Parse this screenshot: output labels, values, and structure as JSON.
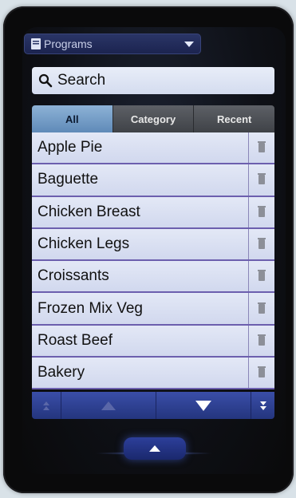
{
  "header": {
    "dropdown_label": "Programs"
  },
  "search": {
    "placeholder": "Search"
  },
  "tabs": [
    {
      "label": "All",
      "active": true
    },
    {
      "label": "Category",
      "active": false
    },
    {
      "label": "Recent",
      "active": false
    }
  ],
  "programs": [
    {
      "name": "Apple Pie"
    },
    {
      "name": "Baguette"
    },
    {
      "name": "Chicken Breast"
    },
    {
      "name": "Chicken Legs"
    },
    {
      "name": "Croissants"
    },
    {
      "name": "Frozen Mix Veg"
    },
    {
      "name": "Roast Beef"
    },
    {
      "name": "Bakery"
    }
  ],
  "icons": {
    "dropdown": "document-icon",
    "dropdown_caret": "chevron-down-icon",
    "search": "search-icon",
    "delete": "trash-icon",
    "scroll_top": "scroll-to-top-icon",
    "scroll_up": "arrow-up-icon",
    "scroll_down": "arrow-down-icon",
    "scroll_bottom": "scroll-to-bottom-icon",
    "handle": "arrow-up-icon"
  },
  "colors": {
    "tab_active": "#7fa6cf",
    "list_row": "#dde3f4",
    "row_divider": "#6c5fae",
    "toolbar": "#2f43a0"
  }
}
